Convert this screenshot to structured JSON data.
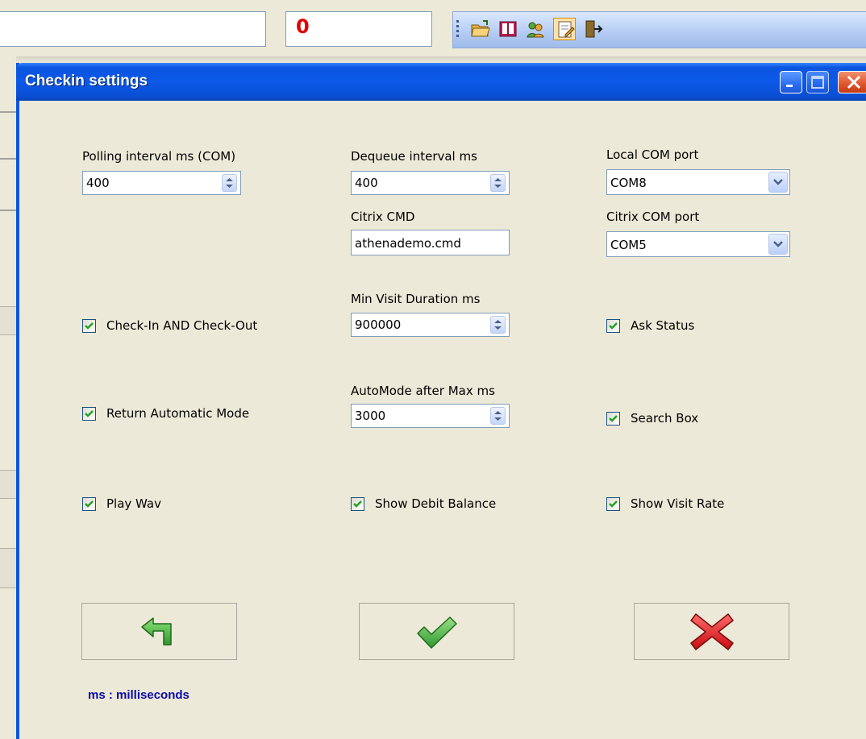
{
  "background_app": {
    "search_value": "",
    "counter_value": "0",
    "toolbar_icons": [
      "open-folder-icon",
      "book-icon",
      "refresh-people-icon",
      "settings-document-icon",
      "exit-door-icon"
    ]
  },
  "dialog": {
    "title": "Checkin settings",
    "polling": {
      "label": "Polling interval ms (COM)",
      "value": "400"
    },
    "dequeue": {
      "label": "Dequeue interval ms",
      "value": "400"
    },
    "local_com": {
      "label": "Local COM port",
      "value": "COM8"
    },
    "citrix_cmd": {
      "label": "Citrix CMD",
      "value": "athenademo.cmd"
    },
    "citrix_com": {
      "label": "Citrix COM port",
      "value": "COM5"
    },
    "min_visit": {
      "label": "Min Visit Duration ms",
      "value": "900000"
    },
    "automode": {
      "label": "AutoMode after Max ms",
      "value": "3000"
    },
    "checkboxes": {
      "checkin_checkout": {
        "label": "Check-In AND Check-Out",
        "checked": true
      },
      "ask_status": {
        "label": "Ask Status",
        "checked": true
      },
      "return_auto": {
        "label": "Return Automatic Mode",
        "checked": true
      },
      "search_box": {
        "label": "Search Box",
        "checked": true
      },
      "play_wav": {
        "label": "Play Wav",
        "checked": true
      },
      "show_debit": {
        "label": "Show Debit Balance",
        "checked": true
      },
      "show_visit_rate": {
        "label": "Show Visit Rate",
        "checked": true
      }
    },
    "buttons": {
      "back_icon": "back-arrow-icon",
      "ok_icon": "checkmark-icon",
      "cancel_icon": "red-x-icon"
    },
    "footnote": "ms : milliseconds"
  },
  "colors": {
    "title_bar": "#0a55e0",
    "counter": "#e00000",
    "footnote": "#0a0aa8",
    "face": "#ece9d8"
  }
}
